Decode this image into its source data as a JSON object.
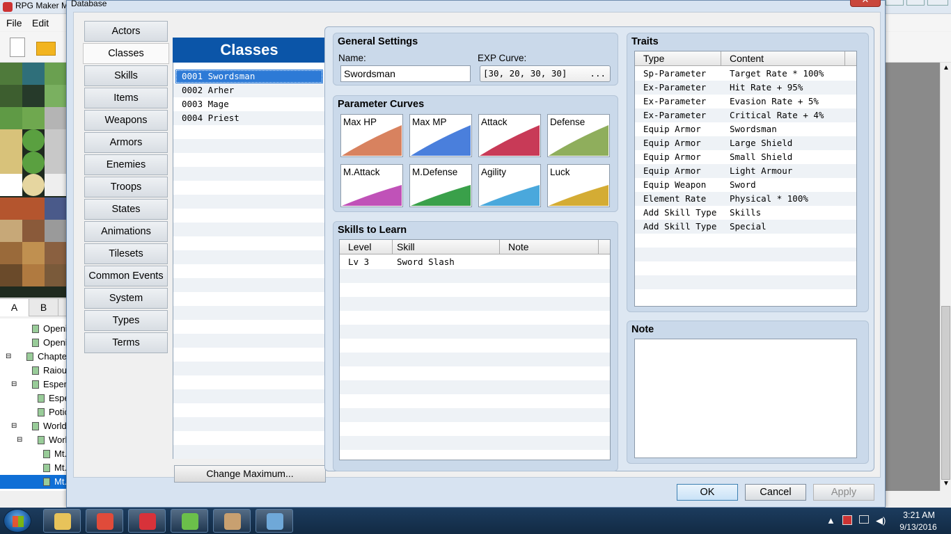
{
  "bg_app": {
    "title": "RPG Maker M",
    "menu": [
      "File",
      "Edit"
    ],
    "tile_tabs": [
      "A",
      "B"
    ],
    "map_tree": [
      {
        "label": "Openir",
        "indent": 1
      },
      {
        "label": "Openir",
        "indent": 1
      },
      {
        "label": "Chapter",
        "indent": 0,
        "expand": "⊟"
      },
      {
        "label": "Raiou",
        "indent": 1
      },
      {
        "label": "Esperc",
        "indent": 1,
        "expand": "⊟"
      },
      {
        "label": "Esper",
        "indent": 2
      },
      {
        "label": "Potic",
        "indent": 2
      },
      {
        "label": "World",
        "indent": 1,
        "expand": "⊟"
      },
      {
        "label": "World",
        "indent": 2,
        "expand": "⊟"
      },
      {
        "label": "Mt.",
        "indent": 3
      },
      {
        "label": "Mt.",
        "indent": 3
      },
      {
        "label": "Mt.",
        "indent": 3,
        "selected": true
      }
    ]
  },
  "dialog": {
    "title": "Database",
    "close": "✕",
    "categories": [
      "Actors",
      "Classes",
      "Skills",
      "Items",
      "Weapons",
      "Armors",
      "Enemies",
      "Troops",
      "States",
      "Animations",
      "Tilesets",
      "Common Events",
      "System",
      "Types",
      "Terms"
    ],
    "selected_category": "Classes",
    "list_title": "Classes",
    "classes": [
      "0001 Swordsman",
      "0002 Arher",
      "0003 Mage",
      "0004 Priest"
    ],
    "change_max": "Change Maximum...",
    "general": {
      "title": "General Settings",
      "name_label": "Name:",
      "name_value": "Swordsman",
      "exp_label": "EXP Curve:",
      "exp_value": "[30, 20, 30, 30]",
      "exp_button": "..."
    },
    "param_curves": {
      "title": "Parameter Curves",
      "items": [
        {
          "label": "Max HP",
          "color": "#d8825f"
        },
        {
          "label": "Max MP",
          "color": "#4a7fdc"
        },
        {
          "label": "Attack",
          "color": "#c83a57"
        },
        {
          "label": "Defense",
          "color": "#8fae5c"
        },
        {
          "label": "M.Attack",
          "color": "#c052b8"
        },
        {
          "label": "M.Defense",
          "color": "#3aa04a"
        },
        {
          "label": "Agility",
          "color": "#4aa8dc"
        },
        {
          "label": "Luck",
          "color": "#d4ac34"
        }
      ]
    },
    "skills": {
      "title": "Skills to Learn",
      "headers": [
        "Level",
        "Skill",
        "Note"
      ],
      "rows": [
        {
          "level": "Lv  3",
          "skill": "Sword Slash",
          "note": ""
        }
      ]
    },
    "traits": {
      "title": "Traits",
      "headers": [
        "Type",
        "Content"
      ],
      "rows": [
        {
          "type": "Sp-Parameter",
          "content": "Target Rate * 100%"
        },
        {
          "type": "Ex-Parameter",
          "content": "Hit Rate + 95%"
        },
        {
          "type": "Ex-Parameter",
          "content": "Evasion Rate + 5%"
        },
        {
          "type": "Ex-Parameter",
          "content": "Critical Rate + 4%"
        },
        {
          "type": "Equip Armor",
          "content": "Swordsman"
        },
        {
          "type": "Equip Armor",
          "content": "Large Shield"
        },
        {
          "type": "Equip Armor",
          "content": "Small Shield"
        },
        {
          "type": "Equip Armor",
          "content": "Light Armour"
        },
        {
          "type": "Equip Weapon",
          "content": "Sword"
        },
        {
          "type": "Element Rate",
          "content": "Physical * 100%"
        },
        {
          "type": "Add Skill Type",
          "content": "Skills"
        },
        {
          "type": "Add Skill Type",
          "content": "Special"
        }
      ]
    },
    "note": {
      "title": "Note",
      "value": ""
    },
    "buttons": {
      "ok": "OK",
      "cancel": "Cancel",
      "apply": "Apply"
    }
  },
  "taskbar": {
    "time": "3:21 AM",
    "date": "9/13/2016",
    "apps": [
      {
        "name": "file-explorer-icon",
        "color": "#e8c35a"
      },
      {
        "name": "chrome-icon",
        "color": "#e04b3a"
      },
      {
        "name": "game-controller-icon",
        "color": "#d8323a"
      },
      {
        "name": "color-wheel-icon",
        "color": "#6bbf4a"
      },
      {
        "name": "rpg-maker-icon",
        "color": "#c8a070"
      },
      {
        "name": "paint-icon",
        "color": "#6fa8d8"
      }
    ]
  }
}
